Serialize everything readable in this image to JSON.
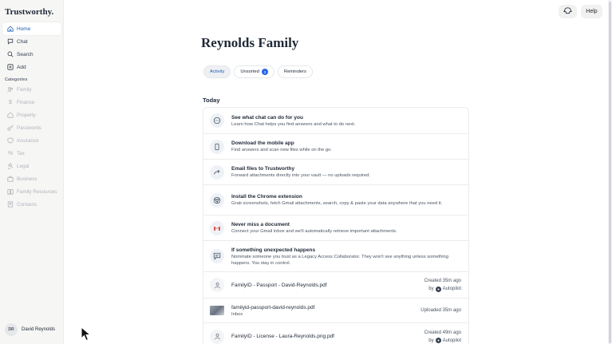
{
  "brand": "Trustworthy.",
  "nav": [
    {
      "label": "Home",
      "icon": "home-icon"
    },
    {
      "label": "Chat",
      "icon": "chat-icon"
    },
    {
      "label": "Search",
      "icon": "search-icon"
    },
    {
      "label": "Add",
      "icon": "add-icon"
    }
  ],
  "categories_title": "Categories",
  "categories": [
    {
      "label": "Family",
      "icon": "people-icon"
    },
    {
      "label": "Finance",
      "icon": "dollar-icon"
    },
    {
      "label": "Property",
      "icon": "house-icon"
    },
    {
      "label": "Passwords",
      "icon": "key-icon"
    },
    {
      "label": "Insurance",
      "icon": "shield-icon"
    },
    {
      "label": "Tax",
      "icon": "percent-icon"
    },
    {
      "label": "Legal",
      "icon": "gavel-icon"
    },
    {
      "label": "Business",
      "icon": "briefcase-icon"
    },
    {
      "label": "Family Resources",
      "icon": "book-icon"
    },
    {
      "label": "Contacts",
      "icon": "contacts-icon"
    }
  ],
  "user": {
    "initials": "DR",
    "name": "David Reynolds"
  },
  "top": {
    "help_label": "Help"
  },
  "page_title": "Reynolds Family",
  "tabs": [
    {
      "label": "Activity"
    },
    {
      "label": "Unsorted",
      "badge": "3"
    },
    {
      "label": "Reminders"
    }
  ],
  "section_title": "Today",
  "items": [
    {
      "title": "See what chat can do for you",
      "sub": "Learn how Chat helps you find answers and what to do next."
    },
    {
      "title": "Download the mobile app",
      "sub": "Find answers and scan new files while on the go."
    },
    {
      "title": "Email files to Trustworthy",
      "sub": "Forward attachments directly into your vault — no uploads required."
    },
    {
      "title": "Install the Chrome extension",
      "sub": "Grab screenshots, fetch Gmail attachments, search, copy & paste your data anywhere that you need it."
    },
    {
      "title": "Never miss a document",
      "sub": "Connect your Gmail inbox and we'll automatically retrieve important attachments."
    },
    {
      "title": "If something unexpected happens",
      "sub": "Nominate someone you trust as a Legacy Access Collaborator. They won't see anything unless something happens. You stay in control."
    }
  ],
  "files": [
    {
      "title": "FamilyID - Passport - David-Reynolds.pdf",
      "meta": "Created 35m ago",
      "by": "by",
      "author": "Autopilot"
    },
    {
      "title": "familyid-passport-david-reynolds.pdf",
      "sub": "Inbox",
      "meta": "Uploaded 35m ago"
    },
    {
      "title": "FamilyID - License - Laura-Reynolds.png.pdf",
      "meta": "Created 49m ago",
      "by": "by",
      "author": "Autopilot"
    }
  ]
}
